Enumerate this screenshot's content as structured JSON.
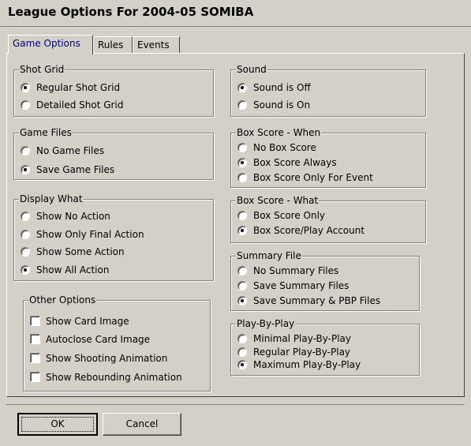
{
  "window": {
    "title": "League Options For 2004-05 SOMIBA"
  },
  "tabs": [
    {
      "label": "Game Options",
      "active": true
    },
    {
      "label": "Rules",
      "active": false
    },
    {
      "label": "Events",
      "active": false
    }
  ],
  "groups": {
    "shot_grid": {
      "legend": "Shot Grid",
      "options": [
        {
          "label": "Regular Shot Grid",
          "checked": true
        },
        {
          "label": "Detailed Shot Grid",
          "checked": false
        }
      ]
    },
    "game_files": {
      "legend": "Game Files",
      "options": [
        {
          "label": "No Game Files",
          "checked": false
        },
        {
          "label": "Save Game Files",
          "checked": true
        }
      ]
    },
    "display_what": {
      "legend": "Display What",
      "options": [
        {
          "label": "Show No Action",
          "checked": false
        },
        {
          "label": "Show Only Final Action",
          "checked": false
        },
        {
          "label": "Show Some Action",
          "checked": false
        },
        {
          "label": "Show All Action",
          "checked": true
        }
      ]
    },
    "other_options": {
      "legend": "Other Options",
      "options": [
        {
          "label": "Show Card Image",
          "checked": false
        },
        {
          "label": "Autoclose Card Image",
          "checked": false
        },
        {
          "label": "Show Shooting Animation",
          "checked": false
        },
        {
          "label": "Show Rebounding Animation",
          "checked": false
        }
      ]
    },
    "sound": {
      "legend": "Sound",
      "options": [
        {
          "label": "Sound is Off",
          "checked": true
        },
        {
          "label": "Sound is On",
          "checked": false
        }
      ]
    },
    "box_score_when": {
      "legend": "Box Score - When",
      "options": [
        {
          "label": "No Box Score",
          "checked": false
        },
        {
          "label": "Box Score Always",
          "checked": true
        },
        {
          "label": "Box Score Only For Event",
          "checked": false
        }
      ]
    },
    "box_score_what": {
      "legend": "Box Score - What",
      "options": [
        {
          "label": "Box Score Only",
          "checked": false
        },
        {
          "label": "Box Score/Play Account",
          "checked": true
        }
      ]
    },
    "summary_file": {
      "legend": "Summary File",
      "options": [
        {
          "label": "No Summary Files",
          "checked": false
        },
        {
          "label": "Save Summary Files",
          "checked": false
        },
        {
          "label": "Save Summary & PBP Files",
          "checked": true
        }
      ]
    },
    "play_by_play": {
      "legend": "Play-By-Play",
      "options": [
        {
          "label": "Minimal Play-By-Play",
          "checked": false
        },
        {
          "label": "Regular Play-By-Play",
          "checked": false
        },
        {
          "label": "Maximum Play-By-Play",
          "checked": true
        }
      ]
    }
  },
  "buttons": {
    "ok": "OK",
    "cancel": "Cancel"
  }
}
